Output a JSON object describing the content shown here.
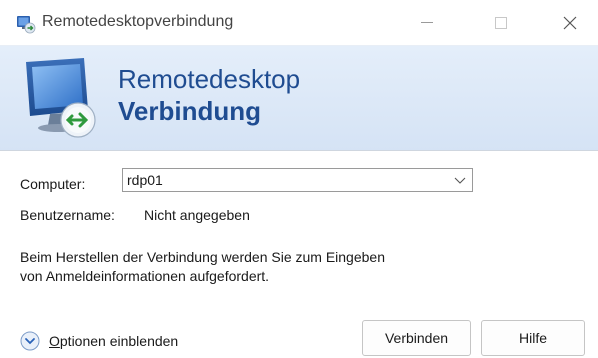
{
  "window": {
    "title": "Remotedesktopverbindung",
    "controls": {
      "minimize_icon": "minimize-icon",
      "maximize_icon": "maximize-icon",
      "close_icon": "close-icon"
    }
  },
  "banner": {
    "line1": "Remotedesktop",
    "line2": "Verbindung",
    "icon": "remote-desktop-monitor-icon"
  },
  "form": {
    "computer_label": "Computer:",
    "computer_value": "rdp01",
    "username_label": "Benutzername:",
    "username_value": "Nicht angegeben",
    "info_line1": "Beim Herstellen der Verbindung werden Sie zum Eingeben",
    "info_line2": "von Anmeldeinformationen aufgefordert."
  },
  "footer": {
    "options_accel": "O",
    "options_rest": "ptionen einblenden",
    "connect_label": "Verbinden",
    "help_label": "Hilfe"
  },
  "colors": {
    "banner_text": "#1f4c91",
    "banner_bg": "#dbe7f7",
    "accent": "#2a62b8"
  }
}
